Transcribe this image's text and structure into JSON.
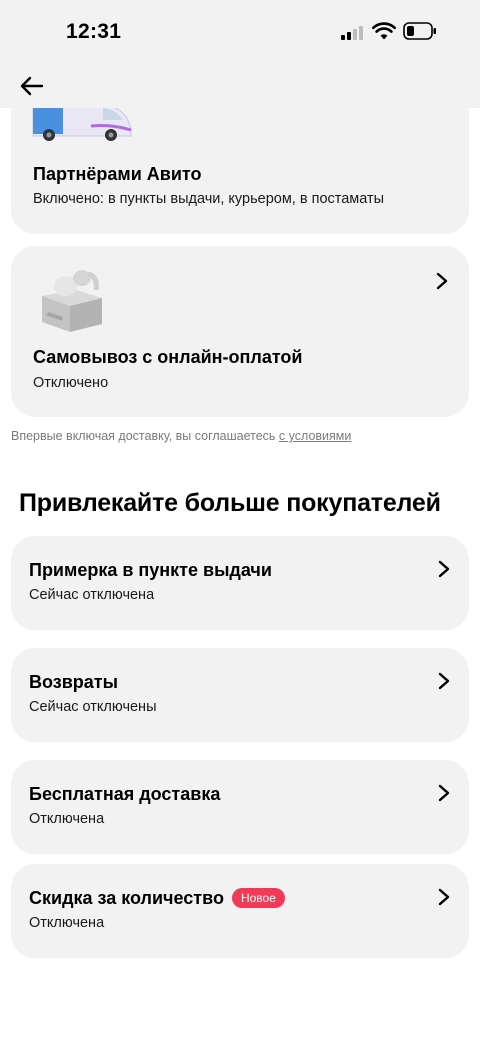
{
  "status_bar": {
    "time": "12:31"
  },
  "delivery_options": [
    {
      "title": "Партнёрами Авито",
      "status": "Включено: в пункты выдачи, курьером, в постаматы"
    },
    {
      "title": "Самовывоз с онлайн-оплатой",
      "status": "Отключено"
    }
  ],
  "terms": {
    "text": "Впервые включая доставку, вы соглашаетесь",
    "link": "с условиями"
  },
  "section": {
    "title": "Привлекайте больше покупателей"
  },
  "features": [
    {
      "title": "Примерка в пункте выдачи",
      "status": "Сейчас отключена"
    },
    {
      "title": "Возвраты",
      "status": "Сейчас отключены"
    },
    {
      "title": "Бесплатная доставка",
      "status": "Отключена"
    },
    {
      "title": "Скидка за количество",
      "badge": "Новое",
      "status": "Отключена"
    }
  ],
  "colors": {
    "card_bg": "#f2f2f2",
    "badge_bg": "#f03a57",
    "muted_text": "#7a7a7a"
  },
  "icons": [
    "back-arrow-icon",
    "chevron-right-icon",
    "van-illustration",
    "box-illustration",
    "signal-icon",
    "wifi-icon",
    "battery-icon"
  ]
}
